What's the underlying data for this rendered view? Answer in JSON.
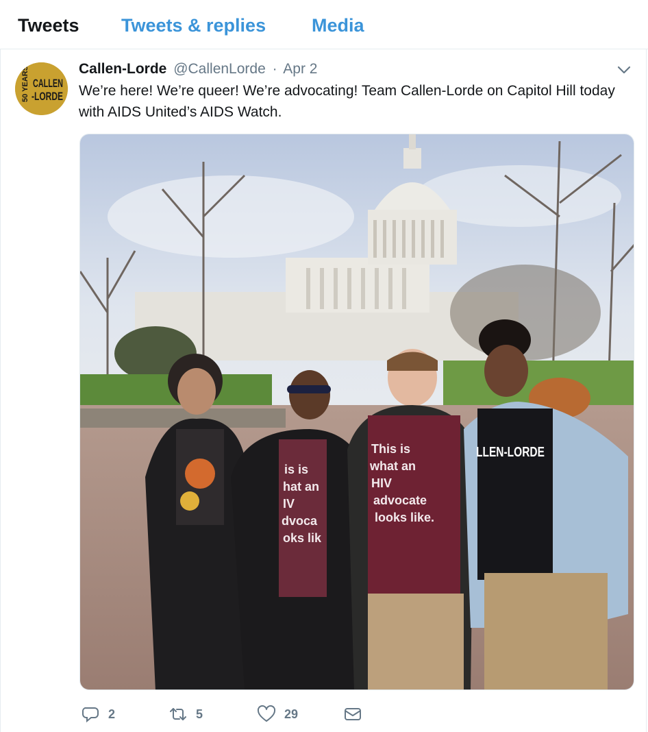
{
  "tabs": [
    {
      "label": "Tweets",
      "active": true
    },
    {
      "label": "Tweets & replies",
      "active": false
    },
    {
      "label": "Media",
      "active": false
    }
  ],
  "tweet": {
    "author_name": "Callen-Lorde",
    "handle": "@CallenLorde",
    "separator": "·",
    "date": "Apr 2",
    "text": "We’re here! We’re queer! We’re advocating! Team Callen-Lorde on Capitol Hill today with AIDS United’s  AIDS Watch.",
    "avatar": {
      "logo_text": "CALLEN-LORDE 50 YEARS",
      "bg_color": "#c9a130"
    },
    "photo": {
      "subject": "four people standing in front of the U.S. Capitol",
      "shirt_text": "This is what an HIV advocate looks like."
    },
    "actions": {
      "reply": {
        "icon": "reply-icon",
        "count": "2"
      },
      "retweet": {
        "icon": "retweet-icon",
        "count": "5"
      },
      "like": {
        "icon": "heart-icon",
        "count": "29"
      },
      "message": {
        "icon": "envelope-icon"
      }
    }
  },
  "colors": {
    "accent": "#3b94d9",
    "text": "#14171a",
    "muted": "#657786",
    "border": "#e6ecf0"
  }
}
